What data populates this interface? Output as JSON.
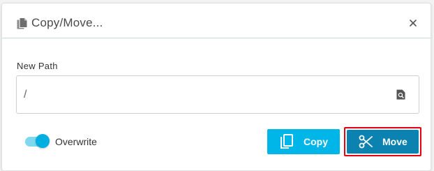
{
  "dialog": {
    "title": "Copy/Move...",
    "title_icon": "file-copy-icon",
    "close_icon": "close-icon"
  },
  "path_field": {
    "label": "New Path",
    "value": "/",
    "trailing_icon": "file-search-icon"
  },
  "overwrite": {
    "label": "Overwrite",
    "enabled": true
  },
  "buttons": {
    "copy": {
      "label": "Copy",
      "icon": "copy-icon"
    },
    "move": {
      "label": "Move",
      "icon": "scissors-icon"
    }
  },
  "colors": {
    "accent": "#00b5e8",
    "move_button": "#0b82b0",
    "highlight_frame": "#e00012",
    "toggle_track": "#7fd8ef",
    "toggle_knob": "#00aee0"
  }
}
